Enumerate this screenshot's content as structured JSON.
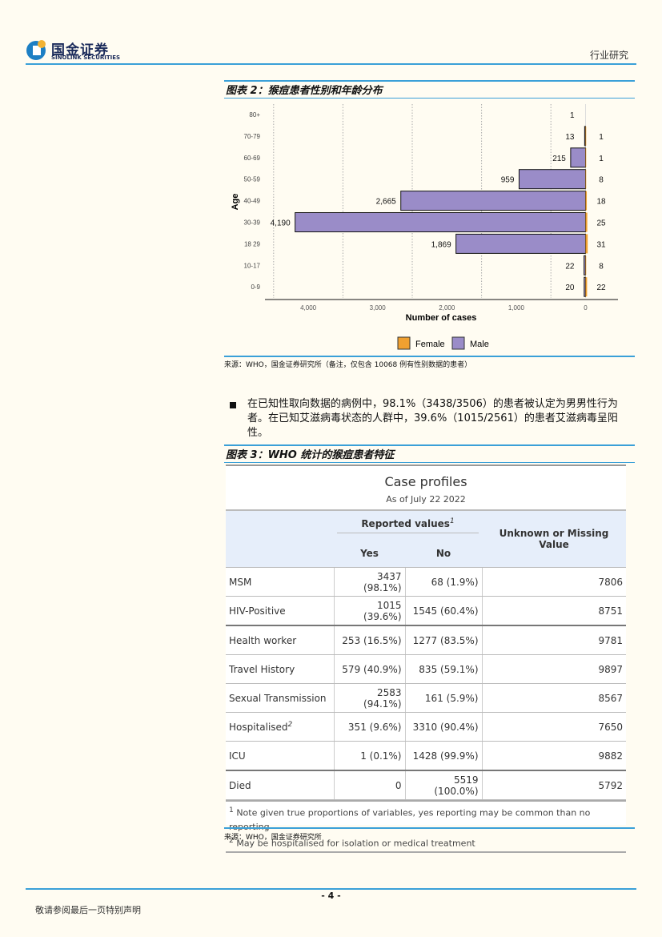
{
  "header": {
    "logo_cn": "国金证券",
    "logo_en": "SINOLINK SECURITIES",
    "section": "行业研究"
  },
  "figure2": {
    "title": "图表 2：猴痘患者性别和年龄分布",
    "source": "来源：WHO，国金证券研究所（备注，仅包含 10068 例有性别数据的患者）"
  },
  "chart_data": {
    "type": "bar",
    "orientation": "horizontal-pyramid",
    "categories": [
      "80+",
      "70-79",
      "60-69",
      "50-59",
      "40-49",
      "30-39",
      "18 29",
      "10-17",
      "0-9"
    ],
    "series": [
      {
        "name": "Female",
        "color": "#f0a030",
        "values": [
          null,
          1,
          1,
          8,
          18,
          25,
          31,
          8,
          22
        ]
      },
      {
        "name": "Male",
        "color": "#9a8cc8",
        "values": [
          1,
          13,
          215,
          959,
          2665,
          4190,
          1869,
          22,
          20
        ]
      }
    ],
    "xlabel": "Number of cases",
    "ylabel": "Age",
    "xticks": [
      "4,000",
      "3,000",
      "2,000",
      "1,000",
      "0"
    ],
    "xlim": [
      4600,
      0
    ],
    "grid": "dotted vertical",
    "legend": "bottom"
  },
  "bullet": {
    "text": "在已知性取向数据的病例中，98.1%（3438/3506）的患者被认定为男男性行为者。在已知艾滋病毒状态的人群中，39.6%（1015/2561）的患者艾滋病毒呈阳性。"
  },
  "figure3": {
    "title": "图表 3：WHO 统计的猴痘患者特征",
    "table_title": "Case profiles",
    "table_subtitle": "As of July 22 2022",
    "group_header": "Reported values",
    "group_sup": "1",
    "col_yes": "Yes",
    "col_no": "No",
    "col_unknown": "Unknown or Missing Value",
    "rows": [
      {
        "label": "MSM",
        "yes": "3437 (98.1%)",
        "no": "68 (1.9%)",
        "unknown": "7806"
      },
      {
        "label": "HIV-Positive",
        "yes": "1015 (39.6%)",
        "no": "1545 (60.4%)",
        "unknown": "8751"
      },
      {
        "label": "Health worker",
        "yes": "253 (16.5%)",
        "no": "1277 (83.5%)",
        "unknown": "9781"
      },
      {
        "label": "Travel History",
        "yes": "579 (40.9%)",
        "no": "835 (59.1%)",
        "unknown": "9897"
      },
      {
        "label": "Sexual Transmission",
        "yes": "2583 (94.1%)",
        "no": "161 (5.9%)",
        "unknown": "8567"
      },
      {
        "label": "Hospitalised",
        "sup": "2",
        "yes": "351 (9.6%)",
        "no": "3310 (90.4%)",
        "unknown": "7650"
      },
      {
        "label": "ICU",
        "yes": "1 (0.1%)",
        "no": "1428 (99.9%)",
        "unknown": "9882"
      },
      {
        "label": "Died",
        "yes": "0",
        "no": "5519 (100.0%)",
        "unknown": "5792"
      }
    ],
    "footnotes": [
      {
        "mark": "1",
        "text": "Note given true proportions of variables, yes reporting may be common than no reporting"
      },
      {
        "mark": "2",
        "text": "May be hospitalised for isolation or medical treatment"
      }
    ],
    "source": "来源：WHO，国金证券研究所"
  },
  "footer": {
    "page": "- 4 -",
    "notice": "敬请参阅最后一页特别声明"
  }
}
